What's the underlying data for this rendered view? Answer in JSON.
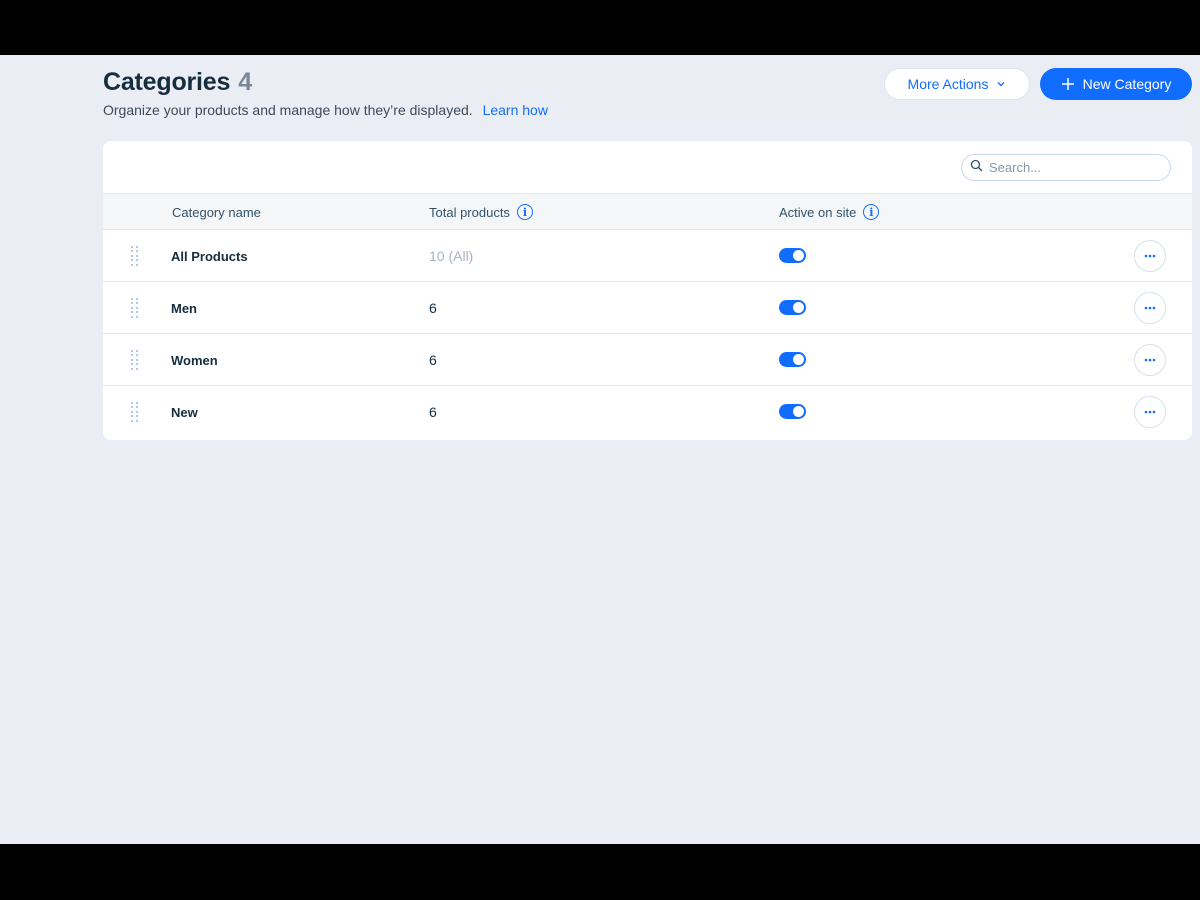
{
  "header": {
    "title": "Categories",
    "count": "4",
    "subtitle": "Organize your products and manage how they’re displayed.",
    "learn_link": "Learn how",
    "more_actions_label": "More Actions",
    "new_category_label": "New Category"
  },
  "search": {
    "placeholder": "Search..."
  },
  "table": {
    "columns": {
      "name": "Category name",
      "total": "Total products",
      "active": "Active on site"
    },
    "rows": [
      {
        "name": "All Products",
        "total": "10 (All)",
        "active": true
      },
      {
        "name": "Men",
        "total": "6",
        "active": true
      },
      {
        "name": "Women",
        "total": "6",
        "active": true
      },
      {
        "name": "New",
        "total": "6",
        "active": true
      }
    ]
  },
  "colors": {
    "accent": "#116dff",
    "background": "#eaeef4",
    "title": "#162d3d",
    "count": "#7a869a"
  },
  "icons": {
    "more_actions": "chevron-down-icon",
    "new_category": "plus-icon",
    "search": "search-icon",
    "info": "info-icon",
    "drag": "drag-handle-icon",
    "row_actions": "ellipsis-icon"
  }
}
